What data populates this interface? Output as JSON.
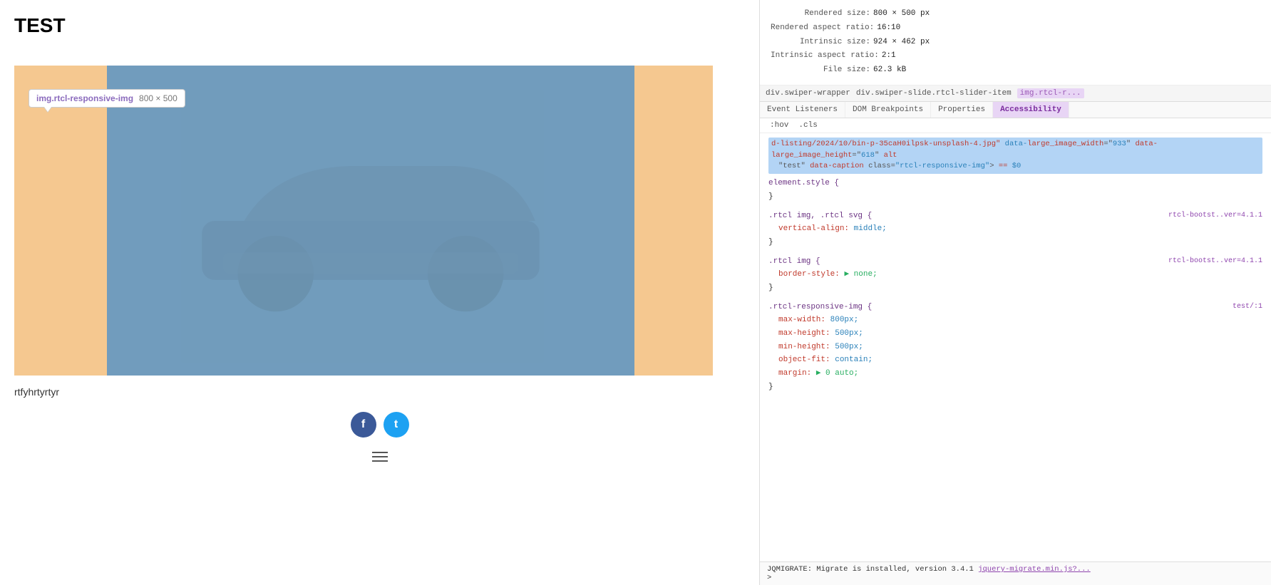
{
  "page": {
    "title": "TEST"
  },
  "tooltip": {
    "class": "img.rtcl-responsive-img",
    "size": "800 × 500"
  },
  "image": {
    "caption": "rtfyhrtyrtyr"
  },
  "social": {
    "facebook_label": "f",
    "twitter_label": "t"
  },
  "devtools": {
    "info": {
      "rendered_size_label": "Rendered size:",
      "rendered_size_val": "800 × 500 px",
      "rendered_aspect_label": "Rendered aspect ratio:",
      "rendered_aspect_val": "16:10",
      "intrinsic_size_label": "Intrinsic size:",
      "intrinsic_size_val": "924 × 462 px",
      "intrinsic_aspect_label": "Intrinsic aspect ratio:",
      "intrinsic_aspect_val": "2:1",
      "file_size_label": "File size:",
      "file_size_val": "62.3 kB"
    },
    "breadcrumb": {
      "items": [
        {
          "label": "div.swiper-wrapper",
          "active": false
        },
        {
          "label": "div.swiper-slide.rtcl-slider-item",
          "active": false
        },
        {
          "label": "img.rtcl-r...",
          "active": true
        }
      ]
    },
    "tabs": [
      {
        "label": "Event Listeners",
        "active": false
      },
      {
        "label": "DOM Breakpoints",
        "active": false
      },
      {
        "label": "Properties",
        "active": false
      },
      {
        "label": "Accessibility",
        "active": true
      }
    ],
    "styles_subtabs": [
      {
        "label": ":hov",
        "active": false
      },
      {
        "label": ".cls",
        "active": false
      }
    ],
    "element_code": {
      "path": "d-listing/2024/10/bin-p-35caH0ilpsk-unsplash-4.jpg\"",
      "attrs": [
        {
          "name": "data-large_image_width",
          "value": "\"933\""
        },
        {
          "name": "data-large_image_height",
          "value": "\"618\""
        },
        {
          "name": "alt",
          "value": "\"test\""
        },
        {
          "name": "data-caption",
          "value": "class=\"rtcl-responsive-img\">"
        },
        {
          "name": "==",
          "value": "$0"
        }
      ]
    },
    "css_rules": [
      {
        "selector": "element.style {",
        "closing": "}",
        "props": [],
        "source": ""
      },
      {
        "selector": ".rtcl img, .rtcl svg {",
        "closing": "}",
        "props": [
          {
            "name": "vertical-align:",
            "value": "middle;"
          }
        ],
        "source": "rtcl-bootst..ver=4.1.1"
      },
      {
        "selector": ".rtcl img {",
        "closing": "}",
        "props": [
          {
            "name": "border-style:",
            "value": "▶ none;"
          }
        ],
        "source": "rtcl-bootst..ver=4.1.1"
      },
      {
        "selector": ".rtcl-responsive-img {",
        "closing": "}",
        "props": [
          {
            "name": "max-width:",
            "value": "800px;"
          },
          {
            "name": "max-height:",
            "value": "500px;"
          },
          {
            "name": "min-height:",
            "value": "500px;"
          },
          {
            "name": "object-fit:",
            "value": "contain;"
          },
          {
            "name": "margin:",
            "value": "▶ 0 auto;"
          }
        ],
        "source": "test/:1"
      }
    ],
    "console": {
      "message": "JQMIGRATE: Migrate is installed, version 3.4.1",
      "link": "jquery-migrate.min.js?..."
    }
  }
}
